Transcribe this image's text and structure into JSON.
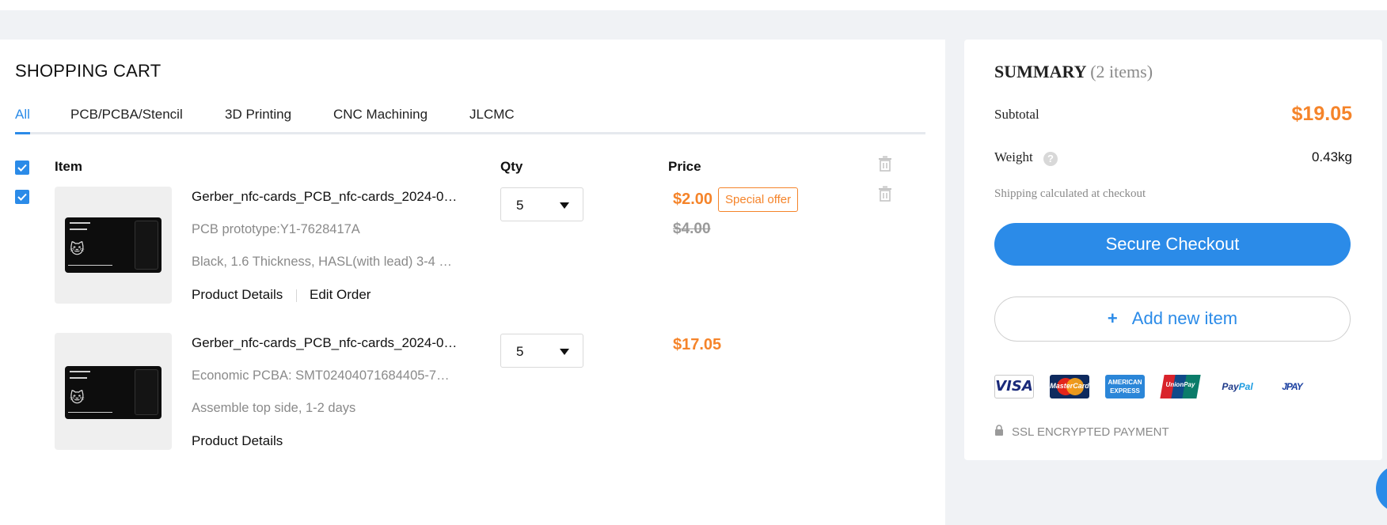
{
  "cart": {
    "title": "SHOPPING CART",
    "tabs": [
      {
        "label": "All",
        "active": true
      },
      {
        "label": "PCB/PCBA/Stencil",
        "active": false
      },
      {
        "label": "3D Printing",
        "active": false
      },
      {
        "label": "CNC Machining",
        "active": false
      },
      {
        "label": "JLCMC",
        "active": false
      }
    ],
    "columns": {
      "item": "Item",
      "qty": "Qty",
      "price": "Price"
    },
    "items": [
      {
        "name": "Gerber_nfc-cards_PCB_nfc-cards_2024-0…",
        "line2": "PCB prototype:Y1-7628417A",
        "line3": "Black, 1.6 Thickness, HASL(with lead) 3-4 …",
        "links": [
          "Product Details",
          "Edit Order"
        ],
        "qty": "5",
        "price": "$2.00",
        "old_price": "$4.00",
        "badge": "Special offer",
        "checked": true
      },
      {
        "name": "Gerber_nfc-cards_PCB_nfc-cards_2024-0…",
        "line2": "Economic PCBA: SMT02404071684405-7…",
        "line3": "Assemble top side, 1-2 days",
        "links": [
          "Product Details"
        ],
        "qty": "5",
        "price": "$17.05"
      }
    ]
  },
  "summary": {
    "title": "SUMMARY",
    "count": "(2 items)",
    "subtotal_label": "Subtotal",
    "subtotal_value": "$19.05",
    "weight_label": "Weight",
    "weight_value": "0.43kg",
    "help_glyph": "?",
    "shipping_note": "Shipping calculated at checkout",
    "checkout_label": "Secure Checkout",
    "add_item_plus": "+",
    "add_item_label": "Add new item",
    "payment_methods": {
      "visa": "VISA",
      "mastercard": "MasterCard",
      "amex": "AMERICAN EXPRESS",
      "unionpay": "UnionPay",
      "paypal_pay": "Pay",
      "paypal_pal": "Pal",
      "jpay": "JPAY"
    },
    "ssl_text": "SSL ENCRYPTED PAYMENT"
  },
  "colors": {
    "accent": "#2b8be8",
    "price": "#f5842a",
    "muted": "#8a8a8a",
    "background": "#f0f2f5"
  },
  "icons": [
    "checkbox-checked-icon",
    "trash-icon",
    "caret-down-icon",
    "help-icon",
    "lock-icon",
    "plus-icon"
  ]
}
